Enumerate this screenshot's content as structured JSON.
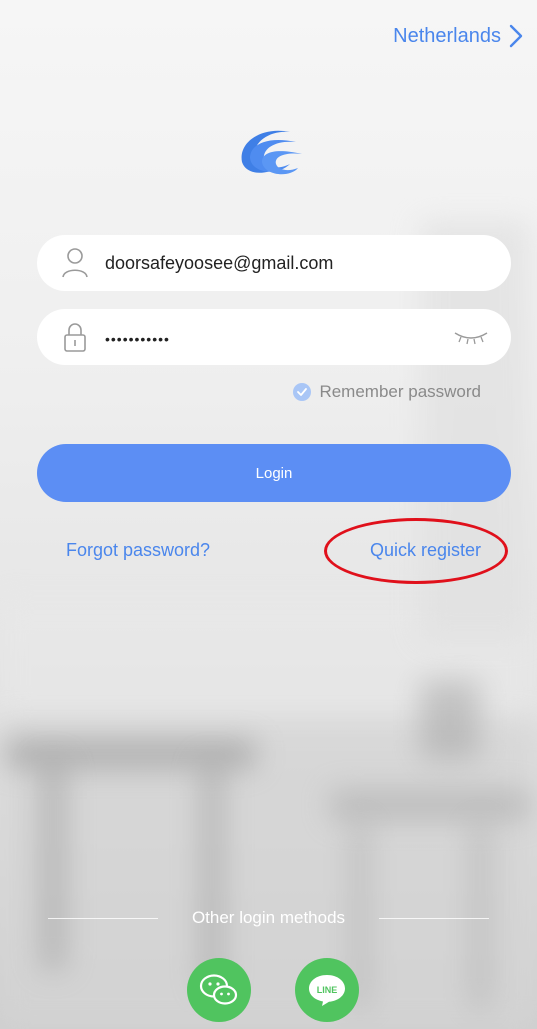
{
  "header": {
    "country": "Netherlands"
  },
  "form": {
    "username": "doorsafeyoosee@gmail.com",
    "password_masked": "•••••••••••",
    "remember_label": "Remember password",
    "login_label": "Login"
  },
  "links": {
    "forgot": "Forgot password?",
    "register": "Quick register"
  },
  "footer": {
    "other_label": "Other login methods",
    "line_label": "LINE"
  },
  "colors": {
    "accent": "#4a86ec",
    "button": "#5c8ef4",
    "social_green": "#50c45f",
    "highlight_red": "#e0101b"
  },
  "icons": [
    "chevron-right-icon",
    "app-logo",
    "user-icon",
    "lock-icon",
    "eye-closed-icon",
    "check-icon",
    "wechat-icon",
    "line-icon"
  ]
}
